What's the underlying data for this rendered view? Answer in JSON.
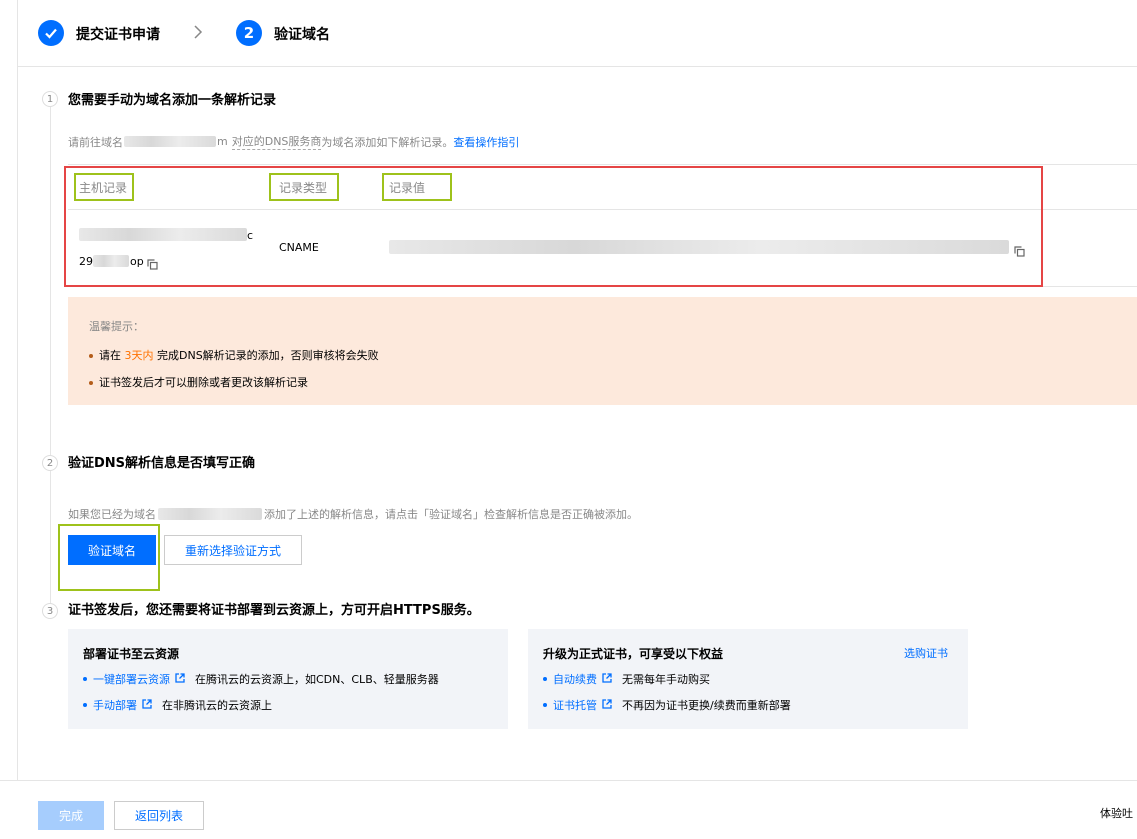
{
  "steps": [
    {
      "label": "提交证书申请",
      "state": "done"
    },
    {
      "label": "验证域名",
      "number": "2",
      "state": "active"
    }
  ],
  "section1": {
    "number": "1",
    "title": "您需要手动为域名添加一条解析记录",
    "desc_prefix": "请前往域名",
    "desc_blur_suffix": "m",
    "desc_dns": "对应的DNS服务商",
    "desc_middle": "为域名添加如下解析记录。",
    "desc_link": "查看操作指引",
    "table": {
      "headers": [
        "主机记录",
        "记录类型",
        "记录值"
      ],
      "row": {
        "host_line1_suffix": "c",
        "host_line2_prefix": "29",
        "host_line2_suffix": "op",
        "type": "CNAME"
      }
    },
    "tips": {
      "title": "温馨提示：",
      "item1_prefix": "请在",
      "item1_highlight": "3天内",
      "item1_suffix": "完成DNS解析记录的添加，否则审核将会失败",
      "item2": "证书签发后才可以删除或者更改该解析记录"
    }
  },
  "section2": {
    "number": "2",
    "title": "验证DNS解析信息是否填写正确",
    "desc_prefix": "如果您已经为域名",
    "desc_suffix": "添加了上述的解析信息，请点击「验证域名」检查解析信息是否正确被添加。",
    "verify_button": "验证域名",
    "reselect_button": "重新选择验证方式"
  },
  "section3": {
    "number": "3",
    "title": "证书签发后，您还需要将证书部署到云资源上，方可开启HTTPS服务。",
    "card1": {
      "title": "部署证书至云资源",
      "items": [
        {
          "link": "一键部署云资源",
          "text": "在腾讯云的云资源上，如CDN、CLB、轻量服务器"
        },
        {
          "link": "手动部署",
          "text": "在非腾讯云的云资源上"
        }
      ]
    },
    "card2": {
      "title": "升级为正式证书，可享受以下权益",
      "action": "选购证书",
      "items": [
        {
          "link": "自动续费",
          "text": "无需每年手动购买"
        },
        {
          "link": "证书托管",
          "text": "不再因为证书更换/续费而重新部署"
        }
      ]
    }
  },
  "footer": {
    "done_button": "完成",
    "back_button": "返回列表",
    "right_text": "体验吐"
  },
  "colors": {
    "primary": "#006eff",
    "highlight_box": "#e54545",
    "annotation_box": "#9ec21b",
    "warning_text": "#ff7200",
    "tip_bg": "#fde9dc"
  }
}
